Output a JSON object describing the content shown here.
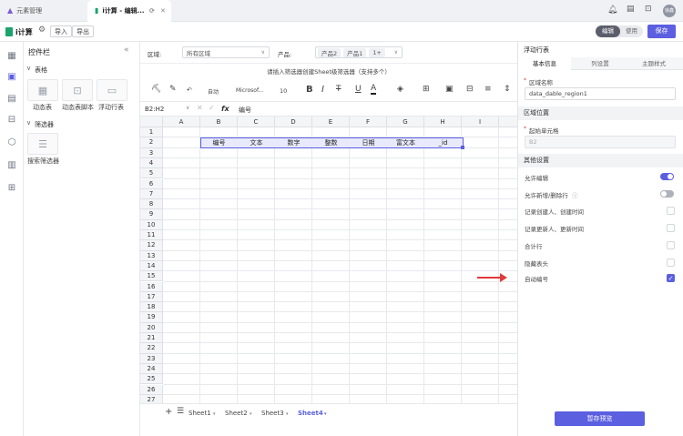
{
  "tabs": [
    {
      "label": "元素管理",
      "active": false
    },
    {
      "label": "i计算 - 编辑...",
      "active": true
    }
  ],
  "app": {
    "name": "i计算",
    "import": "导入",
    "export": "导出",
    "mode_edit": "编辑",
    "mode_use": "使用",
    "save": "保存",
    "avatar": "徐鑫"
  },
  "sidebar": {
    "title": "控件栏",
    "group_table": "表格",
    "widgets": [
      "动态表",
      "动态表脚本",
      "浮动行表"
    ],
    "group_filter": "筛选器",
    "filter_widgets": [
      "搜索筛选器"
    ]
  },
  "filterbar": {
    "region_label": "区域:",
    "region_value": "所有区域",
    "product_label": "产品:",
    "products": [
      "产品2",
      "产品1",
      "1+"
    ]
  },
  "hint": "请插入筛选器创建Sheet级筛选器（支持多个）",
  "ribbon": {
    "format": "自动",
    "font": "Microsof...",
    "size": "10"
  },
  "formula": {
    "cellref": "B2:H2",
    "fx": "fx",
    "value": "编号"
  },
  "grid": {
    "columns": [
      "A",
      "B",
      "C",
      "D",
      "E",
      "F",
      "G",
      "H",
      "I"
    ],
    "rows": [
      "1",
      "2",
      "3",
      "4",
      "5",
      "6",
      "7",
      "8",
      "9",
      "10",
      "11",
      "12",
      "13",
      "14",
      "15",
      "16",
      "17",
      "18",
      "19",
      "20",
      "21",
      "22",
      "23",
      "24",
      "25",
      "26",
      "27"
    ],
    "row2": [
      "编号",
      "文本",
      "数字",
      "整数",
      "日期",
      "富文本",
      "_id"
    ]
  },
  "sheets": [
    "Sheet1",
    "Sheet2",
    "Sheet3",
    "Sheet4"
  ],
  "panel": {
    "title": "浮动行表",
    "tabs": [
      "基本信息",
      "列设置",
      "主题样式"
    ],
    "name_label": "区域名称",
    "name_value": "data_dable_region1",
    "pos_section": "区域位置",
    "start_label": "起始单元格",
    "start_value": "B2",
    "other_section": "其他设置",
    "options": [
      {
        "label": "允许编辑",
        "type": "toggle",
        "on": true
      },
      {
        "label": "允许新增/删除行",
        "type": "toggle",
        "on": false
      },
      {
        "label": "记录创建人、创建时间",
        "type": "checkbox",
        "checked": false
      },
      {
        "label": "记录更新人、更新时间",
        "type": "checkbox",
        "checked": false
      },
      {
        "label": "合计行",
        "type": "checkbox",
        "checked": false
      },
      {
        "label": "隐藏表头",
        "type": "checkbox",
        "checked": false
      },
      {
        "label": "自动编号",
        "type": "checkbox",
        "checked": true
      }
    ],
    "preview_button": "暂存预览"
  },
  "colors": {
    "accent": "#5b5fe0",
    "arrow": "#e03a3a"
  }
}
